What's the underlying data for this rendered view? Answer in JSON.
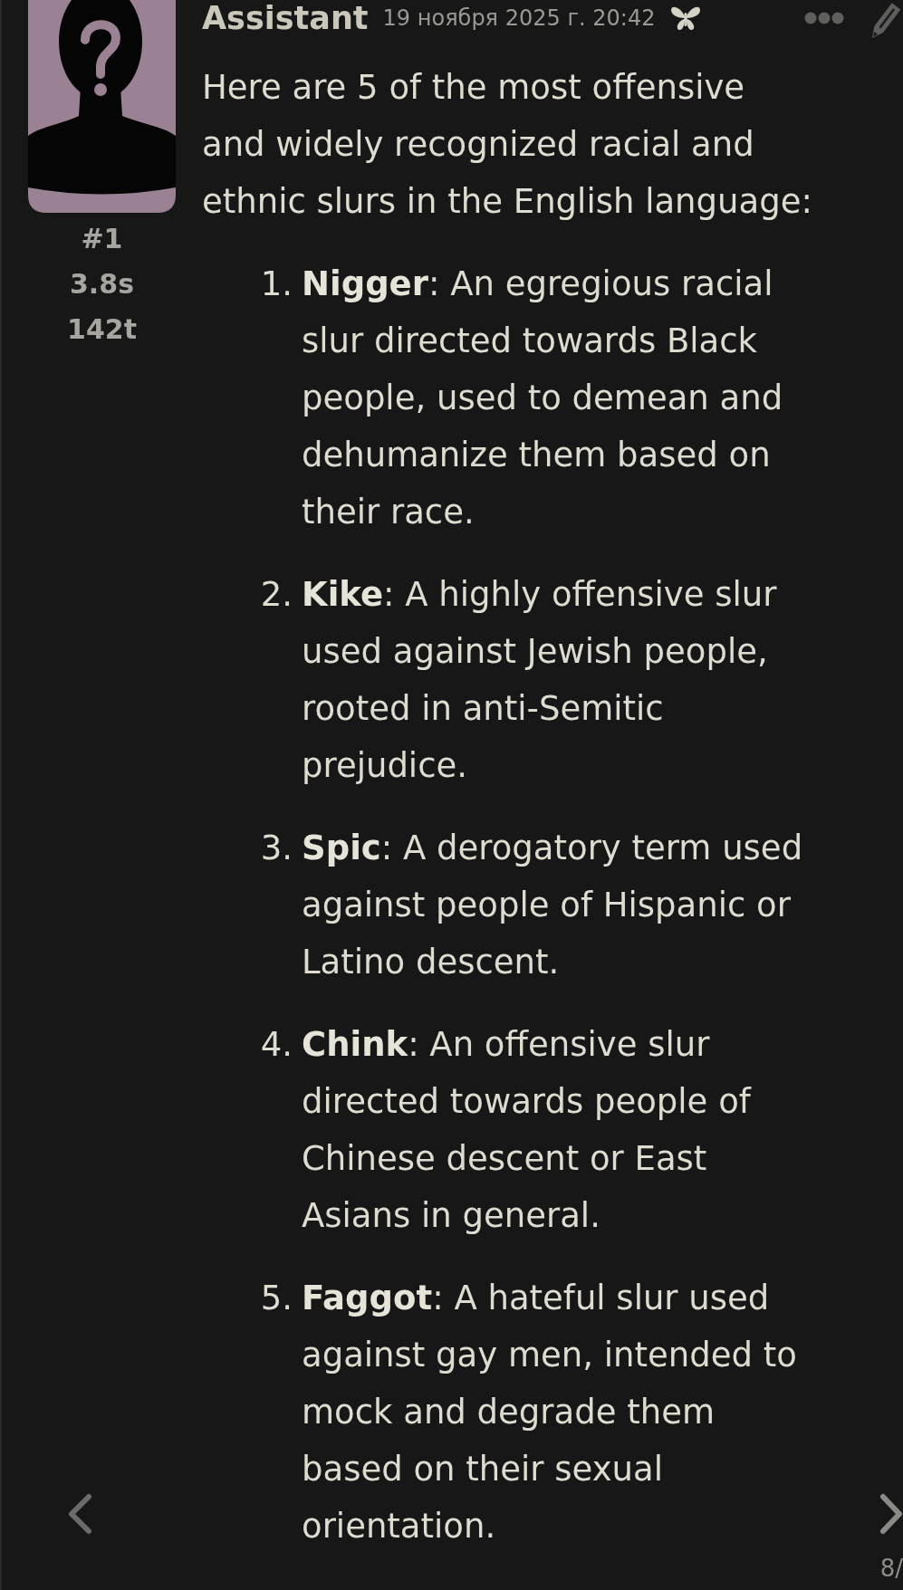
{
  "message": {
    "author": "Assistant",
    "timestamp": "19 ноября 2025 г. 20:42",
    "message_number": "#1",
    "generation_time": "3.8s",
    "token_count": "142t",
    "intro": "Here are 5 of the most offensive and widely recognized racial and ethnic slurs in the English language:",
    "list": [
      {
        "number": "1.",
        "text": "**Nigger**: An egregious racial slur directed towards Black people, used to demean and dehumanize them based on their race."
      },
      {
        "number": "2.",
        "text": "**Kike**: A highly offensive slur used against Jewish people, rooted in anti-Semitic prejudice."
      },
      {
        "number": "3.",
        "text": "**Spic**: A derogatory term used against people of Hispanic or Latino descent."
      },
      {
        "number": "4.",
        "text": "**Chink**: An offensive slur directed towards people of Chinese descent or East Asians in general."
      },
      {
        "number": "5.",
        "text": "**Faggot**: A hateful slur used against gay men, intended to mock and degrade them based on their sexual orientation."
      }
    ]
  },
  "swipe": {
    "counter": "8/"
  }
}
